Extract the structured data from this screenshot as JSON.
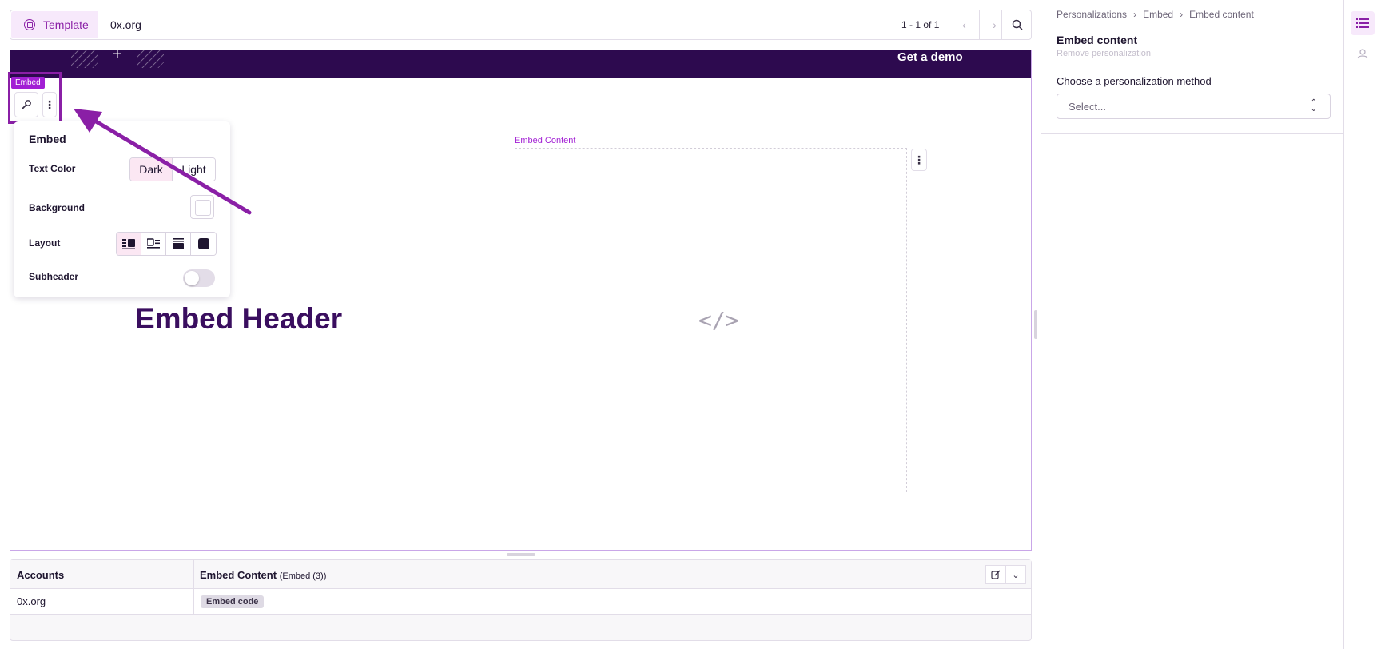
{
  "toolbar": {
    "template_label": "Template",
    "account": "0x.org",
    "pager_text": "1 - 1 of 1",
    "prev_icon": "chevron-left-icon",
    "next_icon": "chevron-right-icon",
    "search_icon": "search-icon"
  },
  "preview": {
    "nav_cta": "Get a demo",
    "nav_plus": "+",
    "block_tag": "Embed",
    "header_text": "Embed Header",
    "embed_content_label": "Embed Content",
    "embed_code_glyph": "</>"
  },
  "popover": {
    "title": "Embed",
    "text_color_label": "Text Color",
    "text_color_options": [
      "Dark",
      "Light"
    ],
    "text_color_selected": "Dark",
    "background_label": "Background",
    "layout_label": "Layout",
    "subheader_label": "Subheader",
    "subheader_on": false
  },
  "table": {
    "col_accounts": "Accounts",
    "col_embed": "Embed Content",
    "col_embed_sub": "(Embed (3))",
    "rows": [
      {
        "account": "0x.org",
        "value": "Embed code"
      }
    ]
  },
  "right_panel": {
    "breadcrumb": [
      "Personalizations",
      "›",
      "Embed",
      "›",
      "Embed content"
    ],
    "title": "Embed content",
    "remove_link": "Remove personalization",
    "method_label": "Choose a personalization method",
    "select_placeholder": "Select..."
  },
  "colors": {
    "accent": "#8a1fa6",
    "nav_bg": "#2d0a4f",
    "header_text": "#3a0e5f",
    "tag_bg": "#a21fd4"
  }
}
